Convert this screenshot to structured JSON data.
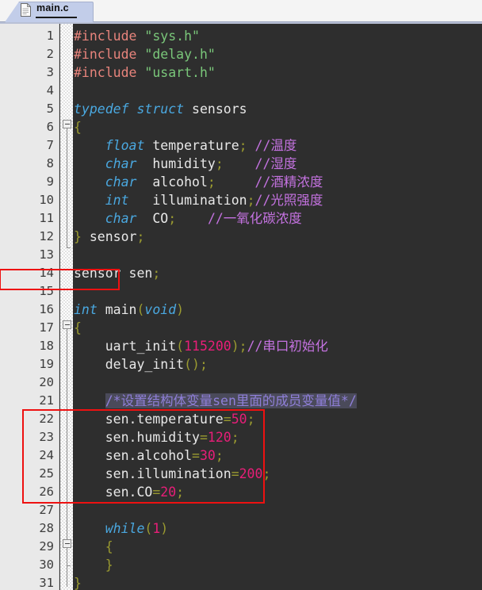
{
  "window": {
    "title": "main.c",
    "bg_color": "#2e2e2e",
    "gutter_color": "#e9e9e9"
  },
  "tab": {
    "label": "main.c",
    "icon": "document-icon",
    "active": true,
    "tab_color": "#c2cde9"
  },
  "editor": {
    "language": "C",
    "first_line": 1,
    "last_line": 31,
    "line_numbers": [
      1,
      2,
      3,
      4,
      5,
      6,
      7,
      8,
      9,
      10,
      11,
      12,
      13,
      14,
      15,
      16,
      17,
      18,
      19,
      20,
      21,
      22,
      23,
      24,
      25,
      26,
      27,
      28,
      29,
      30,
      31
    ],
    "lines": [
      {
        "n": 1,
        "text": "#include \"sys.h\""
      },
      {
        "n": 2,
        "text": "#include \"delay.h\""
      },
      {
        "n": 3,
        "text": "#include \"usart.h\""
      },
      {
        "n": 4,
        "text": ""
      },
      {
        "n": 5,
        "text": "typedef struct sensors"
      },
      {
        "n": 6,
        "text": "{"
      },
      {
        "n": 7,
        "text": "    float temperature; //温度"
      },
      {
        "n": 8,
        "text": "    char  humidity;    //湿度"
      },
      {
        "n": 9,
        "text": "    char  alcohol;      //酒精浓度"
      },
      {
        "n": 10,
        "text": "    int   illumination;//光照强度"
      },
      {
        "n": 11,
        "text": "    char  CO;     //一氧化碳浓度"
      },
      {
        "n": 12,
        "text": "} sensor;"
      },
      {
        "n": 13,
        "text": ""
      },
      {
        "n": 14,
        "text": "sensor sen;"
      },
      {
        "n": 15,
        "text": ""
      },
      {
        "n": 16,
        "text": "int main(void)"
      },
      {
        "n": 17,
        "text": "{"
      },
      {
        "n": 18,
        "text": "    uart_init(115200);//串口初始化"
      },
      {
        "n": 19,
        "text": "    delay_init();"
      },
      {
        "n": 20,
        "text": ""
      },
      {
        "n": 21,
        "text": "    /*设置结构体变量sen里面的成员变量值*/"
      },
      {
        "n": 22,
        "text": "    sen.temperature=50;"
      },
      {
        "n": 23,
        "text": "    sen.humidity=120;"
      },
      {
        "n": 24,
        "text": "    sen.alcohol=30;"
      },
      {
        "n": 25,
        "text": "    sen.illumination=200;"
      },
      {
        "n": 26,
        "text": "    sen.CO=20;"
      },
      {
        "n": 27,
        "text": ""
      },
      {
        "n": 28,
        "text": "    while(1)"
      },
      {
        "n": 29,
        "text": "    {"
      },
      {
        "n": 30,
        "text": "    }"
      },
      {
        "n": 31,
        "text": "}"
      }
    ],
    "tokens": {
      "l1": [
        [
          "pp",
          "#include"
        ],
        [
          "id",
          " "
        ],
        [
          "str",
          "\"sys.h\""
        ]
      ],
      "l2": [
        [
          "pp",
          "#include"
        ],
        [
          "id",
          " "
        ],
        [
          "str",
          "\"delay.h\""
        ]
      ],
      "l3": [
        [
          "pp",
          "#include"
        ],
        [
          "id",
          " "
        ],
        [
          "str",
          "\"usart.h\""
        ]
      ],
      "l5": [
        [
          "kw",
          "typedef"
        ],
        [
          "id",
          " "
        ],
        [
          "kw",
          "struct"
        ],
        [
          "id",
          " sensors"
        ]
      ],
      "l6": [
        [
          "brc",
          "{"
        ]
      ],
      "l7": [
        [
          "id",
          "    "
        ],
        [
          "kw",
          "float"
        ],
        [
          "id",
          " temperature"
        ],
        [
          "pun",
          ";"
        ],
        [
          "id",
          " "
        ],
        [
          "cmt",
          "//温度"
        ]
      ],
      "l8": [
        [
          "id",
          "    "
        ],
        [
          "kw",
          "char"
        ],
        [
          "id",
          "  humidity"
        ],
        [
          "pun",
          ";"
        ],
        [
          "id",
          "    "
        ],
        [
          "cmt",
          "//湿度"
        ]
      ],
      "l9": [
        [
          "id",
          "    "
        ],
        [
          "kw",
          "char"
        ],
        [
          "id",
          "  alcohol"
        ],
        [
          "pun",
          ";"
        ],
        [
          "id",
          "     "
        ],
        [
          "cmt",
          "//酒精浓度"
        ]
      ],
      "l10": [
        [
          "id",
          "    "
        ],
        [
          "kw",
          "int"
        ],
        [
          "id",
          "   illumination"
        ],
        [
          "pun",
          ";"
        ],
        [
          "cmt",
          "//光照强度"
        ]
      ],
      "l11": [
        [
          "id",
          "    "
        ],
        [
          "kw",
          "char"
        ],
        [
          "id",
          "  CO"
        ],
        [
          "pun",
          ";"
        ],
        [
          "id",
          "    "
        ],
        [
          "cmt",
          "//一氧化碳浓度"
        ]
      ],
      "l12": [
        [
          "brc",
          "}"
        ],
        [
          "id",
          " sensor"
        ],
        [
          "pun",
          ";"
        ]
      ],
      "l14": [
        [
          "id",
          "sensor sen"
        ],
        [
          "pun",
          ";"
        ]
      ],
      "l16": [
        [
          "kw",
          "int"
        ],
        [
          "id",
          " main"
        ],
        [
          "pun",
          "("
        ],
        [
          "kw",
          "void"
        ],
        [
          "pun",
          ")"
        ]
      ],
      "l17": [
        [
          "brc",
          "{"
        ]
      ],
      "l18": [
        [
          "id",
          "    uart_init"
        ],
        [
          "pun",
          "("
        ],
        [
          "num",
          "115200"
        ],
        [
          "pun",
          ");"
        ],
        [
          "cmt",
          "//串口初始化"
        ]
      ],
      "l19": [
        [
          "id",
          "    delay_init"
        ],
        [
          "pun",
          "();"
        ]
      ],
      "l21": [
        [
          "id",
          "    "
        ],
        [
          "cmt2",
          "/*设置结构体变量sen里面的成员变量值*/"
        ]
      ],
      "l22": [
        [
          "id",
          "    sen.temperature"
        ],
        [
          "pun",
          "="
        ],
        [
          "num",
          "50"
        ],
        [
          "pun",
          ";"
        ]
      ],
      "l23": [
        [
          "id",
          "    sen.humidity"
        ],
        [
          "pun",
          "="
        ],
        [
          "num",
          "120"
        ],
        [
          "pun",
          ";"
        ]
      ],
      "l24": [
        [
          "id",
          "    sen.alcohol"
        ],
        [
          "pun",
          "="
        ],
        [
          "num",
          "30"
        ],
        [
          "pun",
          ";"
        ]
      ],
      "l25": [
        [
          "id",
          "    sen.illumination"
        ],
        [
          "pun",
          "="
        ],
        [
          "num",
          "200"
        ],
        [
          "pun",
          ";"
        ]
      ],
      "l26": [
        [
          "id",
          "    sen.CO"
        ],
        [
          "pun",
          "="
        ],
        [
          "num",
          "20"
        ],
        [
          "pun",
          ";"
        ]
      ],
      "l28": [
        [
          "id",
          "    "
        ],
        [
          "kw",
          "while"
        ],
        [
          "pun",
          "("
        ],
        [
          "num",
          "1"
        ],
        [
          "pun",
          ")"
        ]
      ],
      "l29": [
        [
          "id",
          "    "
        ],
        [
          "brc",
          "{"
        ]
      ],
      "l30": [
        [
          "id",
          "    "
        ],
        [
          "brc",
          "}"
        ]
      ],
      "l31": [
        [
          "brc",
          "}"
        ]
      ]
    },
    "fold_markers": [
      {
        "line": 6,
        "type": "collapse-box"
      },
      {
        "line": 17,
        "type": "collapse-box"
      },
      {
        "line": 29,
        "type": "collapse-box"
      }
    ],
    "colors": {
      "background": "#2e2e2e",
      "default_text": "#e8e8e8",
      "keyword": "#4aa8e0",
      "preprocessor": "#e8847c",
      "string": "#7ac77a",
      "comment": "#c472e0",
      "block_comment_selected": "#8f7fd8",
      "number": "#e81e78",
      "punctuation": "#9a9a30",
      "brace": "#9a9a30",
      "linenumber": "#3c3c3c",
      "annotation": "#ee1111"
    }
  },
  "annotations": [
    {
      "id": "highlight-struct-variable",
      "target_lines": [
        14
      ],
      "color": "#ee1111"
    },
    {
      "id": "highlight-member-assignments",
      "target_lines": [
        22,
        23,
        24,
        25,
        26
      ],
      "color": "#ee1111"
    }
  ]
}
